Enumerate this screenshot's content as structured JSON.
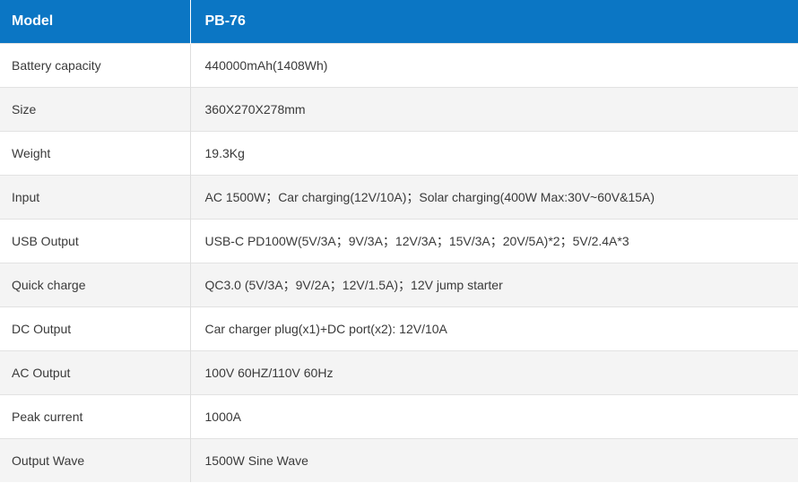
{
  "header": {
    "col1": "Model",
    "col2": "PB-76"
  },
  "rows": [
    {
      "label": "Battery capacity",
      "value": "440000mAh(1408Wh)"
    },
    {
      "label": "Size",
      "value": "360X270X278mm"
    },
    {
      "label": "Weight",
      "value": "19.3Kg"
    },
    {
      "label": "Input",
      "value": "AC 1500W；Car charging(12V/10A)；Solar charging(400W Max:30V~60V&15A)"
    },
    {
      "label": "USB Output",
      "value": "USB-C PD100W(5V/3A；9V/3A；12V/3A；15V/3A；20V/5A)*2；5V/2.4A*3"
    },
    {
      "label": "Quick charge",
      "value": "QC3.0 (5V/3A；9V/2A；12V/1.5A)；12V jump starter"
    },
    {
      "label": "DC Output",
      "value": "Car charger plug(x1)+DC port(x2): 12V/10A"
    },
    {
      "label": "AC Output",
      "value": "100V 60HZ/110V 60Hz"
    },
    {
      "label": "Peak current",
      "value": "1000A"
    },
    {
      "label": "Output Wave",
      "value": "1500W Sine Wave"
    }
  ],
  "colors": {
    "header_bg": "#0b76c4",
    "header_text": "#ffffff",
    "row_alt_bg": "#f4f4f4"
  }
}
